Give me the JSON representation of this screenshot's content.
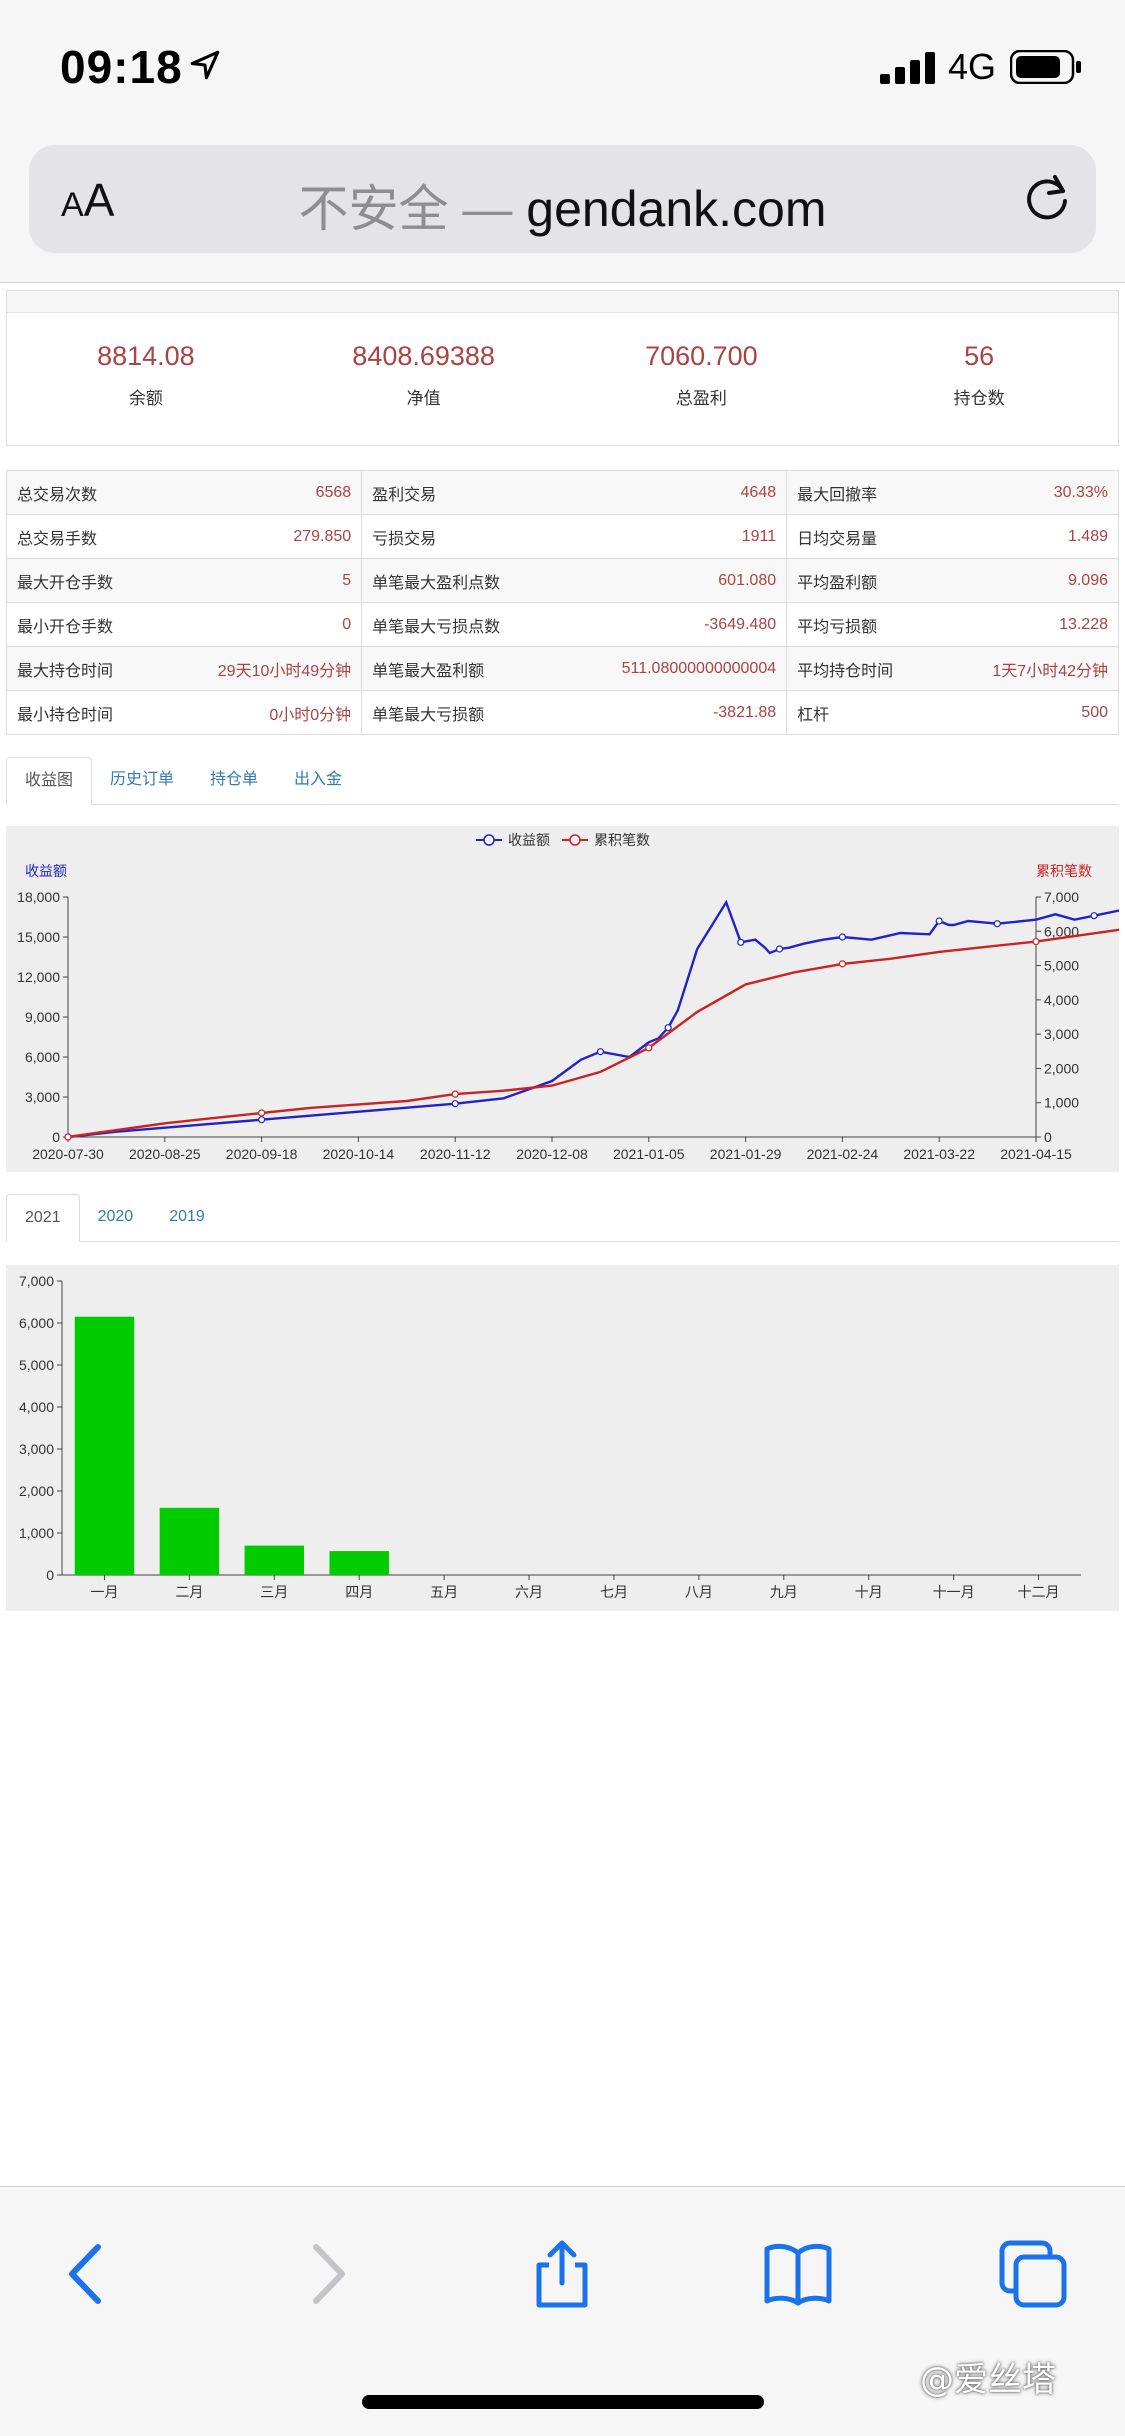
{
  "status_bar": {
    "time": "09:18",
    "network": "4G"
  },
  "browser": {
    "aa_small": "A",
    "aa_large": "A",
    "insecure_label": "不安全 — ",
    "host": "gendank.com"
  },
  "summary": [
    {
      "value": "8814.08",
      "label": "余额"
    },
    {
      "value": "8408.69388",
      "label": "净值"
    },
    {
      "value": "7060.700",
      "label": "总盈利"
    },
    {
      "value": "56",
      "label": "持仓数"
    }
  ],
  "stats": [
    [
      {
        "label": "总交易次数",
        "value": "6568"
      },
      {
        "label": "盈利交易",
        "value": "4648"
      },
      {
        "label": "最大回撤率",
        "value": "30.33%"
      }
    ],
    [
      {
        "label": "总交易手数",
        "value": "279.850"
      },
      {
        "label": "亏损交易",
        "value": "1911"
      },
      {
        "label": "日均交易量",
        "value": "1.489"
      }
    ],
    [
      {
        "label": "最大开仓手数",
        "value": "5"
      },
      {
        "label": "单笔最大盈利点数",
        "value": "601.080"
      },
      {
        "label": "平均盈利额",
        "value": "9.096"
      }
    ],
    [
      {
        "label": "最小开仓手数",
        "value": "0"
      },
      {
        "label": "单笔最大亏损点数",
        "value": "-3649.480"
      },
      {
        "label": "平均亏损额",
        "value": "13.228"
      }
    ],
    [
      {
        "label": "最大持仓时间",
        "value": "29天10小时49分钟"
      },
      {
        "label": "单笔最大盈利额",
        "value": "511.08000000000004"
      },
      {
        "label": "平均持仓时间",
        "value": "1天7小时42分钟"
      }
    ],
    [
      {
        "label": "最小持仓时间",
        "value": "0小时0分钟"
      },
      {
        "label": "单笔最大亏损额",
        "value": "-3821.88"
      },
      {
        "label": "杠杆",
        "value": "500"
      }
    ]
  ],
  "tabs_main": [
    "收益图",
    "历史订单",
    "持仓单",
    "出入金"
  ],
  "tabs_year": [
    "2021",
    "2020",
    "2019"
  ],
  "chart_data": [
    {
      "type": "line",
      "legend": [
        "收益额",
        "累积笔数"
      ],
      "legend_position": "top-center",
      "ylabel_left": "收益额",
      "ylabel_right": "累积笔数",
      "ylim_left": [
        0,
        18000
      ],
      "ylim_right": [
        0,
        7000
      ],
      "yticks_left": [
        "18,000",
        "15,000",
        "12,000",
        "9,000",
        "6,000",
        "3,000",
        "0"
      ],
      "yticks_right": [
        "7,000",
        "6,000",
        "5,000",
        "4,000",
        "3,000",
        "2,000",
        "1,000",
        "0"
      ],
      "xticks": [
        "2020-07-30",
        "2020-08-25",
        "2020-09-18",
        "2020-10-14",
        "2020-11-12",
        "2020-12-08",
        "2021-01-05",
        "2021-01-29",
        "2021-02-24",
        "2021-03-22",
        "2021-04-15"
      ],
      "grid": false,
      "series": [
        {
          "name": "收益额",
          "axis": "left",
          "color": "#2222cc",
          "x": [
            0,
            0.5,
            1,
            1.5,
            2,
            2.5,
            3,
            3.5,
            4,
            4.5,
            5,
            5.3,
            5.5,
            5.8,
            6.0,
            6.1,
            6.2,
            6.3,
            6.5,
            6.8,
            6.95,
            7.1,
            7.2,
            7.25,
            7.35,
            7.45,
            7.6,
            7.8,
            8,
            8.3,
            8.6,
            8.9,
            9,
            9.1,
            9.15,
            9.3,
            9.6,
            10,
            10.2,
            10.4,
            10.6,
            11
          ],
          "y": [
            0,
            400,
            700,
            1000,
            1300,
            1600,
            1900,
            2200,
            2500,
            2900,
            4200,
            5800,
            6400,
            6000,
            7100,
            7400,
            8200,
            9500,
            14100,
            17600,
            14600,
            14800,
            14200,
            13800,
            14100,
            14200,
            14500,
            14800,
            15000,
            14800,
            15300,
            15200,
            16200,
            15900,
            15900,
            16200,
            16000,
            16300,
            16700,
            16300,
            16600,
            17200
          ]
        },
        {
          "name": "累积笔数",
          "axis": "right",
          "color": "#cc2222",
          "x": [
            0,
            0.5,
            1,
            1.5,
            2,
            2.5,
            3,
            3.5,
            4,
            4.5,
            5,
            5.5,
            6,
            6.5,
            7,
            7.5,
            8,
            8.5,
            9,
            9.5,
            10,
            10.5,
            11
          ],
          "y": [
            0,
            200,
            400,
            550,
            700,
            850,
            950,
            1050,
            1250,
            1350,
            1500,
            1900,
            2600,
            3650,
            4450,
            4800,
            5050,
            5200,
            5400,
            5550,
            5700,
            5900,
            6100
          ]
        }
      ]
    },
    {
      "type": "bar",
      "categories": [
        "一月",
        "二月",
        "三月",
        "四月",
        "五月",
        "六月",
        "七月",
        "八月",
        "九月",
        "十月",
        "十一月",
        "十二月"
      ],
      "values": [
        6150,
        1600,
        700,
        570,
        0,
        0,
        0,
        0,
        0,
        0,
        0,
        0
      ],
      "ylim": [
        0,
        7000
      ],
      "yticks": [
        "7,000",
        "6,000",
        "5,000",
        "4,000",
        "3,000",
        "2,000",
        "1,000",
        "0"
      ],
      "color": "#00cc00",
      "grid": false
    }
  ],
  "watermark": "@爱丝塔"
}
